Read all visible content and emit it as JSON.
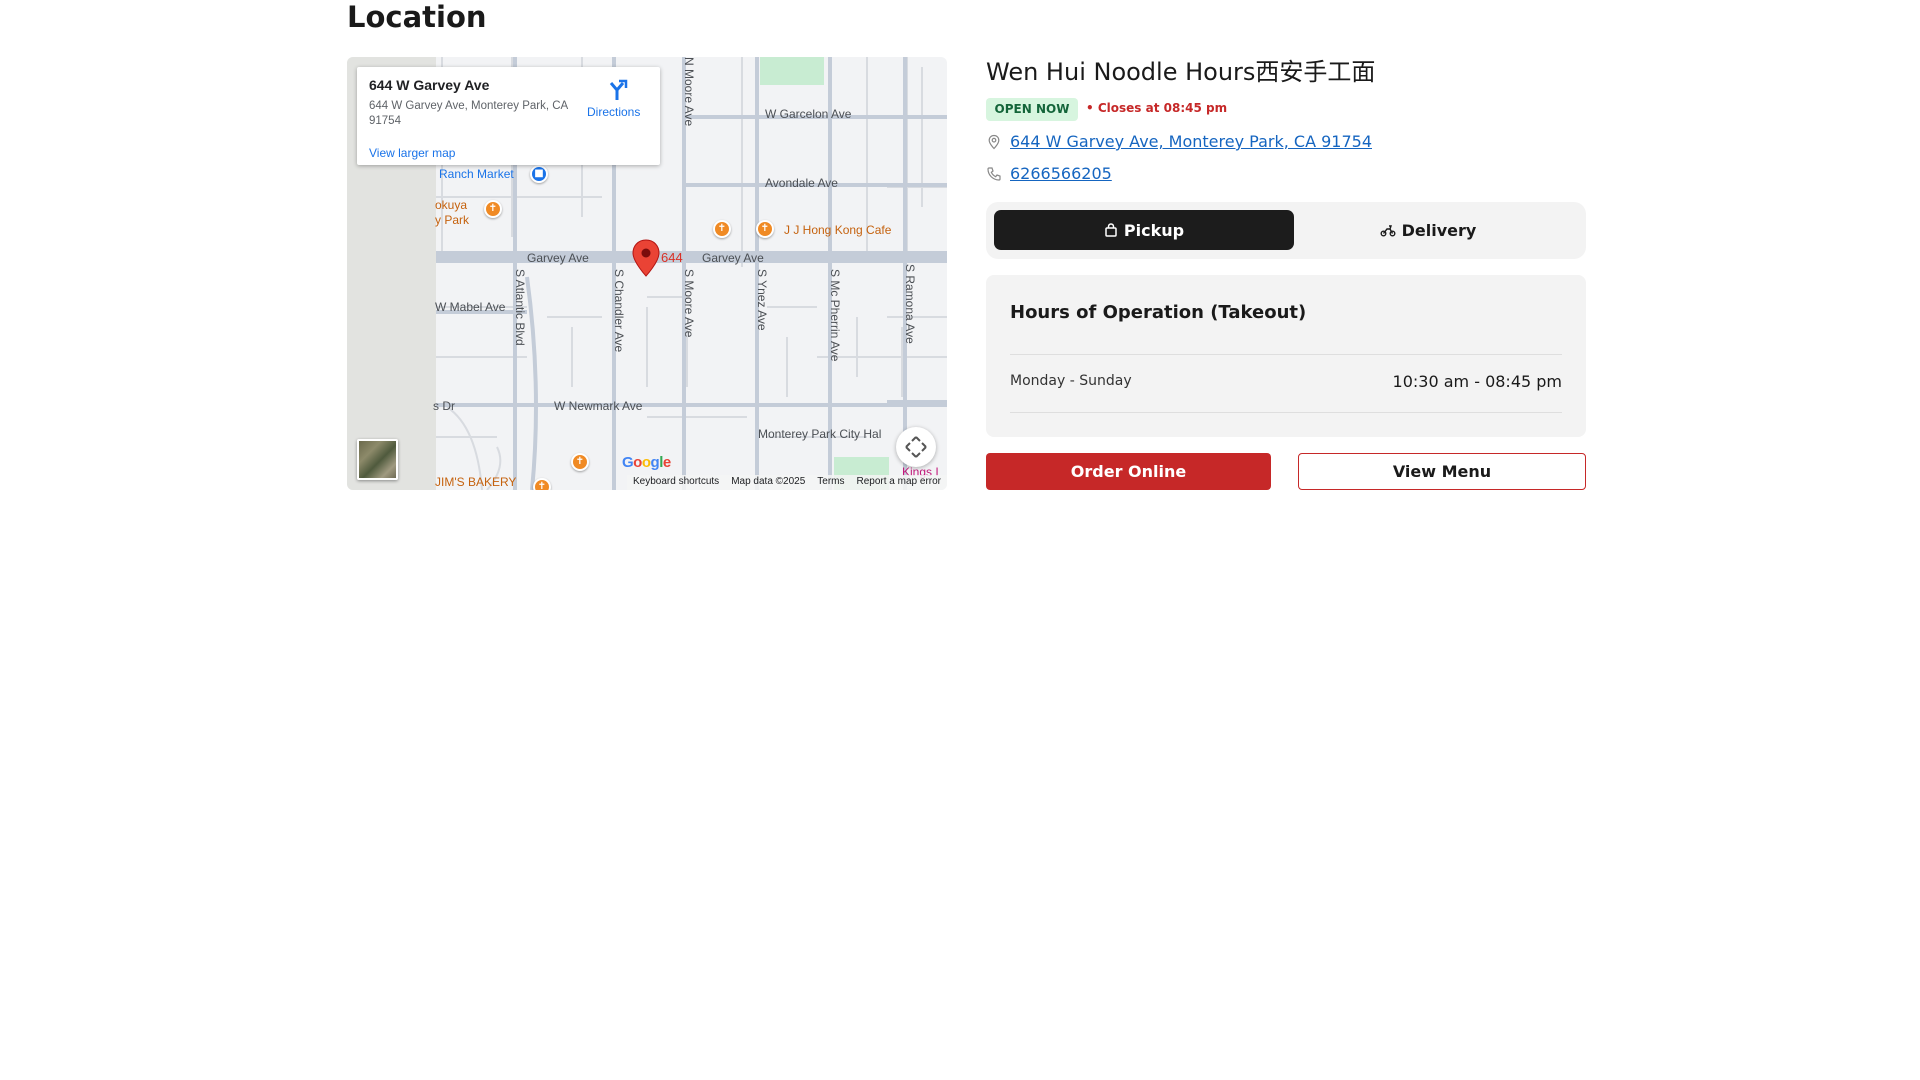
{
  "section": {
    "title": "Location"
  },
  "map": {
    "info_card": {
      "title": "644 W Garvey Ave",
      "address": "644 W Garvey Ave, Monterey Park, CA 91754",
      "directions_label": "Directions",
      "larger_map_link": "View larger map"
    },
    "streets": {
      "w_garcelon": "W Garcelon Ave",
      "avondale": "Avondale Ave",
      "garvey_left": "Garvey Ave",
      "garvey_right": "Garvey Ave",
      "w_mabel": "W Mabel Ave",
      "w_newmark": "W Newmark Ave",
      "n_moore": "N Moore Ave",
      "s_atlantic": "S Atlantic Blvd",
      "s_chandler": "S Chandler Ave",
      "s_moore": "S Moore Ave",
      "s_ynez": "S Ynez Ave",
      "s_mc_pherrin": "S Mc Pherrin Ave",
      "s_ramona": "S Ramona Ave",
      "dr_fragment": "s Dr"
    },
    "pois": {
      "ranch_market": "Ranch Market",
      "kokuya_line1": "okuya",
      "kokuya_line2": "y Park",
      "jj_hong_kong": "J J Hong Kong Cafe",
      "monterey_park_city_hall": "Monterey Park City Hal",
      "jims_bakery": "JIM'S BAKERY",
      "kings": "Kings I"
    },
    "pin_label": "644",
    "google_logo": "Google",
    "attribution": {
      "shortcuts": "Keyboard shortcuts",
      "map_data": "Map data ©2025",
      "terms": "Terms",
      "report": "Report a map error"
    }
  },
  "restaurant": {
    "name": "Wen Hui Noodle Hours西安手工面",
    "status_badge": "OPEN NOW",
    "closes_text": "• Closes at 08:45 pm",
    "address": "644 W Garvey Ave, Monterey Park, CA 91754",
    "phone": "6266566205"
  },
  "order_mode": {
    "pickup_label": "Pickup",
    "delivery_label": "Delivery",
    "selected": "Pickup"
  },
  "hours": {
    "title": "Hours of Operation (Takeout)",
    "rows": [
      {
        "days": "Monday - Sunday",
        "time": "10:30 am - 08:45 pm"
      }
    ]
  },
  "actions": {
    "order_online": "Order Online",
    "view_menu": "View Menu"
  },
  "colors": {
    "brand_red": "#c62828",
    "open_green_bg": "#d7f5df",
    "open_green_text": "#14653a",
    "link_blue": "#1565c0"
  }
}
